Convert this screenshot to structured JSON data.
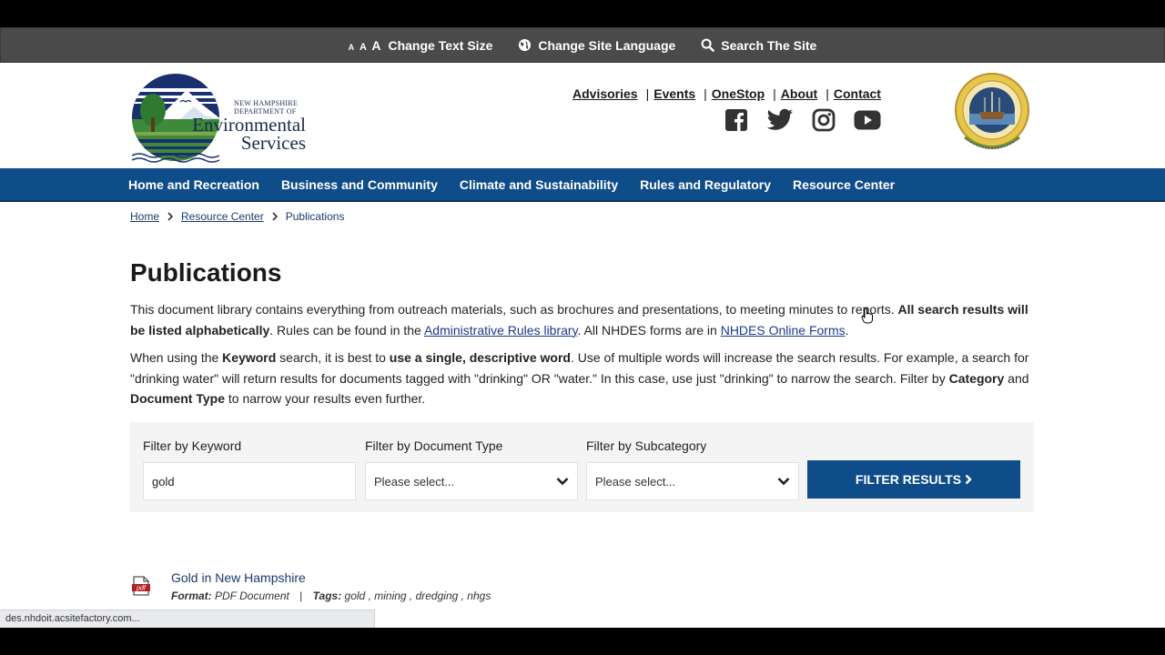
{
  "utility": {
    "text_size_glyph": [
      "A",
      "A",
      "A"
    ],
    "text_size": "Change Text Size",
    "language": "Change Site Language",
    "search": "Search The Site"
  },
  "logo": {
    "agency_small": [
      "NEW HAMPSHIRE",
      "DEPARTMENT OF"
    ],
    "agency_big": [
      "Environmental",
      "Services"
    ]
  },
  "toplinks": [
    "Advisories",
    "Events",
    "OneStop",
    "About",
    "Contact"
  ],
  "social_icons": [
    "facebook-icon",
    "twitter-icon",
    "instagram-icon",
    "youtube-icon"
  ],
  "nav": [
    "Home and Recreation",
    "Business and Community",
    "Climate and Sustainability",
    "Rules and Regulatory",
    "Resource Center"
  ],
  "breadcrumb": [
    "Home",
    "Resource Center",
    "Publications"
  ],
  "page": {
    "title": "Publications",
    "p1": {
      "a": "This document library contains everything from outreach materials, such as brochures and presentations, to meeting minutes to reports. ",
      "b": "All search results will be listed alphabetically",
      "c": ". Rules can be found in the ",
      "link1": "Administrative Rules library",
      "d": ". All NHDES forms are in ",
      "link2": "NHDES Online Forms",
      "e": "."
    },
    "p2": {
      "a": "When using the ",
      "b": "Keyword",
      "c": " search, it is best to ",
      "d": "use a single, descriptive word",
      "e": ". Use of multiple words will increase the search results. For example, a search for \"drinking water\" will return results for documents tagged with \"drinking\" OR \"water.\" In this case, use just \"drinking\" to narrow the search. Filter by ",
      "f": "Category",
      "g": " and ",
      "h": "Document Type",
      "i": " to narrow your results even further."
    }
  },
  "filters": {
    "keyword_label": "Filter by Keyword",
    "keyword_value": "gold",
    "doctype_label": "Filter by Document Type",
    "doctype_value": "Please select...",
    "subcat_label": "Filter by Subcategory",
    "subcat_value": "Please select...",
    "button": "FILTER RESULTS"
  },
  "results": [
    {
      "title": "Gold in New Hampshire",
      "format_label": "Format:",
      "format": "PDF Document",
      "tags_label": "Tags:",
      "tags": "gold , mining , dredging , nhgs",
      "icon_text": "pdf"
    }
  ],
  "statusbar": "des.nhdoit.acsitefactory.com...",
  "colors": {
    "nav_blue": "#0e4c8a",
    "utility_gray": "#4a4a4a",
    "link_blue": "#1a3a8a"
  }
}
